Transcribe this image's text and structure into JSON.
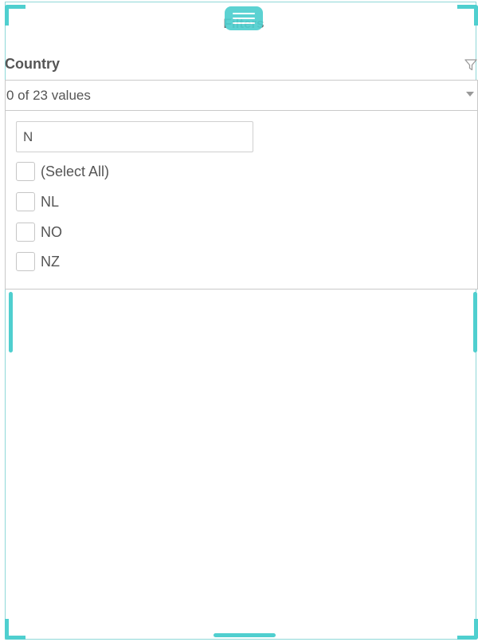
{
  "panel": {
    "title": "Filters",
    "field_label": "Country",
    "values_summary": "0 of 23 values",
    "search": {
      "value": "N",
      "placeholder": ""
    },
    "options": [
      {
        "label": "(Select All)",
        "checked": false
      },
      {
        "label": "NL",
        "checked": false
      },
      {
        "label": "NO",
        "checked": false
      },
      {
        "label": "NZ",
        "checked": false
      }
    ]
  },
  "colors": {
    "accent": "#4fcfcf",
    "text": "#555555",
    "border": "#c9c9c9"
  },
  "icons": {
    "drag": "drag-handle-icon",
    "filter": "filter-icon",
    "dropdown": "chevron-down-icon"
  }
}
